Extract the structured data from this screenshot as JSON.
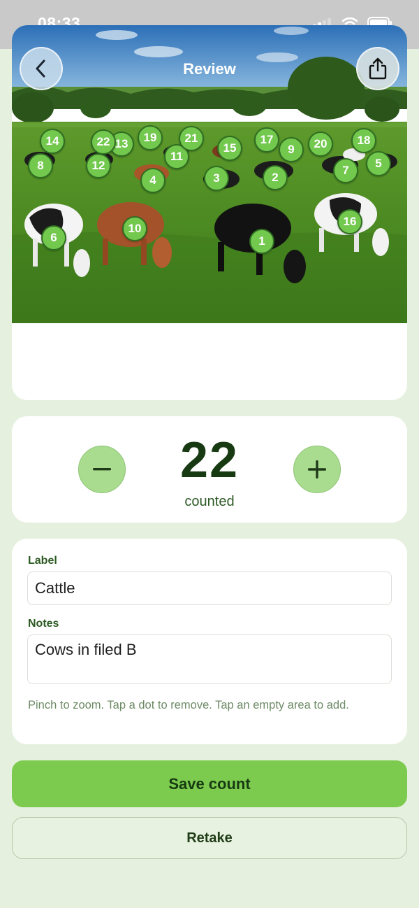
{
  "status_bar": {
    "time": "08:33"
  },
  "header": {
    "title": "Review"
  },
  "markers": [
    {
      "n": "1"
    },
    {
      "n": "2"
    },
    {
      "n": "3"
    },
    {
      "n": "4"
    },
    {
      "n": "5"
    },
    {
      "n": "6"
    },
    {
      "n": "7"
    },
    {
      "n": "8"
    },
    {
      "n": "9"
    },
    {
      "n": "10"
    },
    {
      "n": "11"
    },
    {
      "n": "12"
    },
    {
      "n": "13"
    },
    {
      "n": "14"
    },
    {
      "n": "15"
    },
    {
      "n": "16"
    },
    {
      "n": "17"
    },
    {
      "n": "18"
    },
    {
      "n": "19"
    },
    {
      "n": "20"
    },
    {
      "n": "21"
    },
    {
      "n": "22"
    }
  ],
  "counter": {
    "value": "22",
    "caption": "counted",
    "decrement_icon": "minus-icon",
    "increment_icon": "plus-icon"
  },
  "form": {
    "label_title": "Label",
    "label_value": "Cattle",
    "notes_title": "Notes",
    "notes_value": "Cows in filed B",
    "hint": "Pinch to zoom. Tap a dot to remove. Tap an empty area to add."
  },
  "actions": {
    "save_label": "Save count",
    "retake_label": "Retake"
  },
  "colors": {
    "accent": "#7ccb4f",
    "dot": "#73c84e",
    "background": "#e6f0df",
    "text_dark": "#173a12"
  }
}
